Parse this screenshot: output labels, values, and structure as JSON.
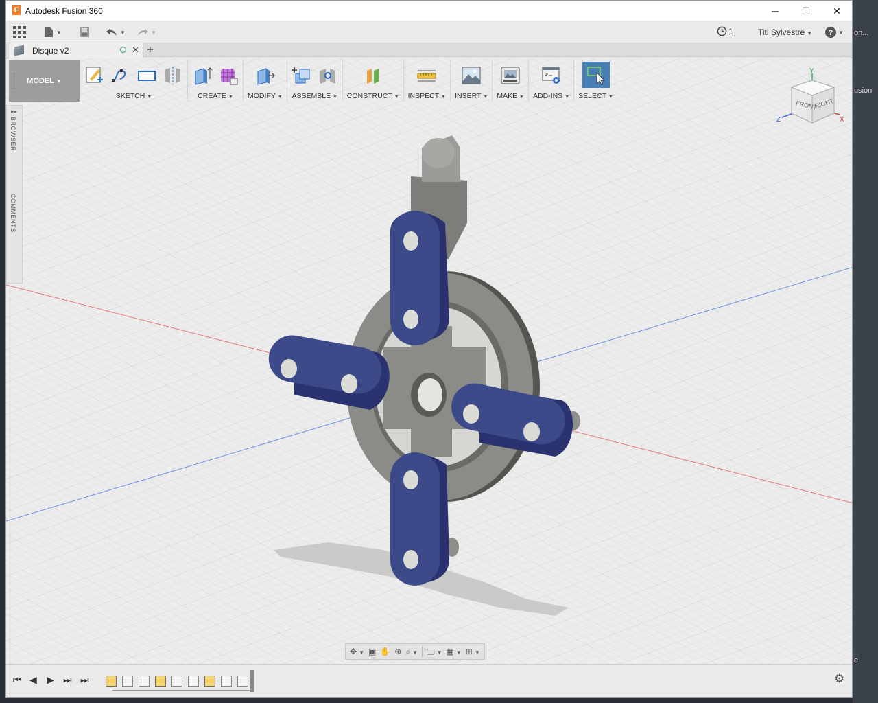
{
  "window": {
    "title": "Autodesk Fusion 360",
    "controls": {
      "minimize": "─",
      "maximize": "☐",
      "close": "✕"
    }
  },
  "right_strip": {
    "top_text": "on...",
    "mid_text": "usion",
    "bottom_text": "e"
  },
  "quick_access": {
    "jobs_count": "1",
    "user_name": "Titi Sylvestre",
    "help": "?"
  },
  "document_tab": {
    "name": "Disque v2",
    "new_tab": "+"
  },
  "toolbar": {
    "workspace": "MODEL",
    "groups": [
      {
        "label": "SKETCH"
      },
      {
        "label": "CREATE"
      },
      {
        "label": "MODIFY"
      },
      {
        "label": "ASSEMBLE"
      },
      {
        "label": "CONSTRUCT"
      },
      {
        "label": "INSPECT"
      },
      {
        "label": "INSERT"
      },
      {
        "label": "MAKE"
      },
      {
        "label": "ADD-INS"
      },
      {
        "label": "SELECT"
      }
    ]
  },
  "side_panel": {
    "browser": "BROWSER",
    "comments": "COMMENTS"
  },
  "viewcube": {
    "front": "FRONT",
    "right": "RIGHT",
    "x": "X",
    "y": "Y",
    "z": "Z"
  },
  "colors": {
    "accent_blue": "#4a7fb5",
    "part_blue": "#3d4a8a",
    "part_grey": "#7b7b77",
    "axis_red": "#e06060",
    "axis_blue": "#5a7ae0"
  },
  "icons": {
    "apps": "grid-icon",
    "file": "file-icon",
    "save": "save-icon",
    "undo": "undo-icon",
    "redo": "redo-icon",
    "jobs": "clock-icon",
    "help": "help-icon",
    "settings": "gear-icon"
  }
}
